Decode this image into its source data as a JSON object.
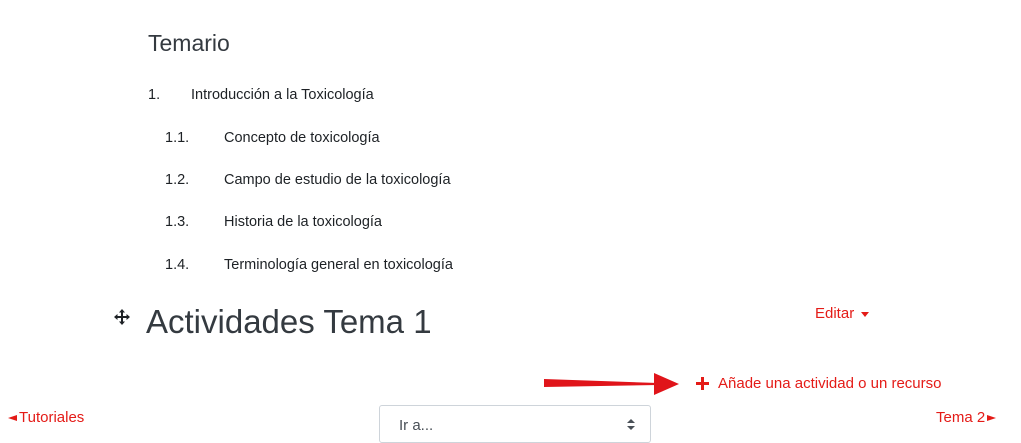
{
  "temario": {
    "title": "Temario",
    "chapter": {
      "number": "1.",
      "title": "Introducción a la Toxicología",
      "subsections": [
        {
          "number": "1.1.",
          "title": "Concepto de toxicología"
        },
        {
          "number": "1.2.",
          "title": "Campo de estudio de la toxicología"
        },
        {
          "number": "1.3.",
          "title": "Historia de la toxicología"
        },
        {
          "number": "1.4.",
          "title": "Terminología general en toxicología"
        }
      ]
    }
  },
  "section": {
    "title": "Actividades Tema 1",
    "edit_label": "Editar",
    "add_label": "Añade una actividad o un recurso"
  },
  "navigation": {
    "prev_label": "Tutoriales",
    "next_label": "Tema 2",
    "jump_placeholder": "Ir a..."
  },
  "colors": {
    "accent": "#e41b17",
    "text": "#1d2125",
    "heading": "#343a40"
  },
  "icons": {
    "drag": "move-arrows-icon",
    "edit_caret": "caret-down-icon",
    "add": "plus-icon",
    "prev": "left-arrow-icon",
    "next": "right-arrow-icon",
    "select": "sort-updown-icon"
  }
}
